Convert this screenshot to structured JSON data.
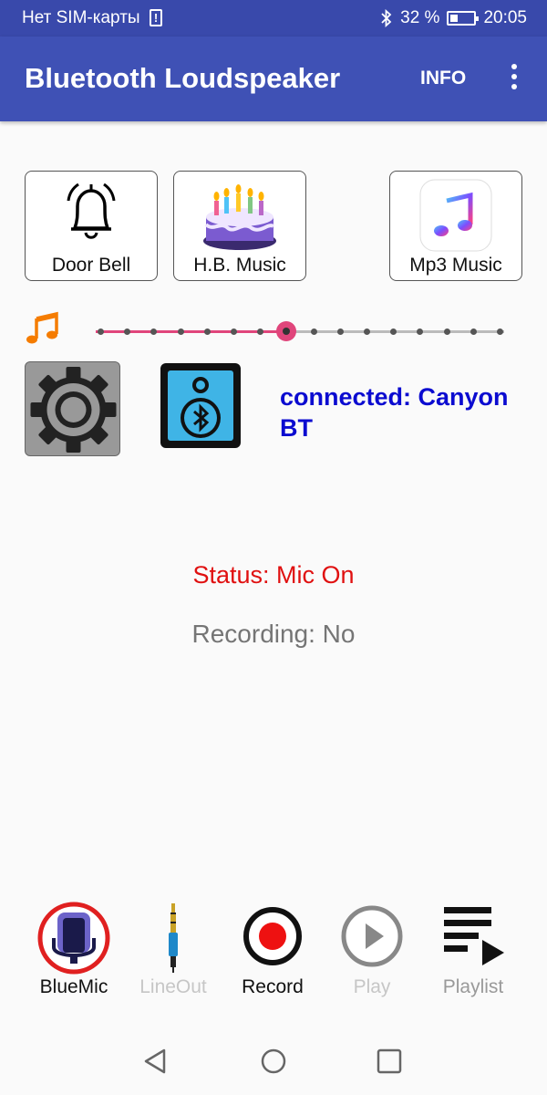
{
  "status_bar": {
    "carrier": "Нет SIM-карты",
    "sim_alert": "!",
    "battery": "32 %",
    "battery_level": 0.32,
    "time": "20:05"
  },
  "app_bar": {
    "title": "Bluetooth Loudspeaker",
    "info_label": "INFO"
  },
  "sound_buttons": [
    {
      "label": "Door Bell",
      "icon": "bell-icon"
    },
    {
      "label": "H.B. Music",
      "icon": "birthday-cake-icon"
    },
    {
      "label": "Mp3 Music",
      "icon": "music-app-icon"
    }
  ],
  "volume": {
    "icon": "music-note-icon",
    "level": 7,
    "max": 15,
    "accent_color": "#e0457b"
  },
  "connection": {
    "text": "connected: Canyon BT",
    "color": "#0b0bd0"
  },
  "status": {
    "status_text": "Status: Mic On",
    "status_color": "#e01010",
    "recording_text": "Recording: No"
  },
  "toolbar": [
    {
      "label": "BlueMic",
      "icon": "microphone-icon",
      "enabled": true
    },
    {
      "label": "LineOut",
      "icon": "audio-jack-icon",
      "enabled": false
    },
    {
      "label": "Record",
      "icon": "record-icon",
      "enabled": true
    },
    {
      "label": "Play",
      "icon": "play-icon",
      "enabled": false
    },
    {
      "label": "Playlist",
      "icon": "playlist-icon",
      "enabled": true
    }
  ],
  "colors": {
    "primary": "#3f51b5",
    "primary_dark": "#3949ab"
  }
}
